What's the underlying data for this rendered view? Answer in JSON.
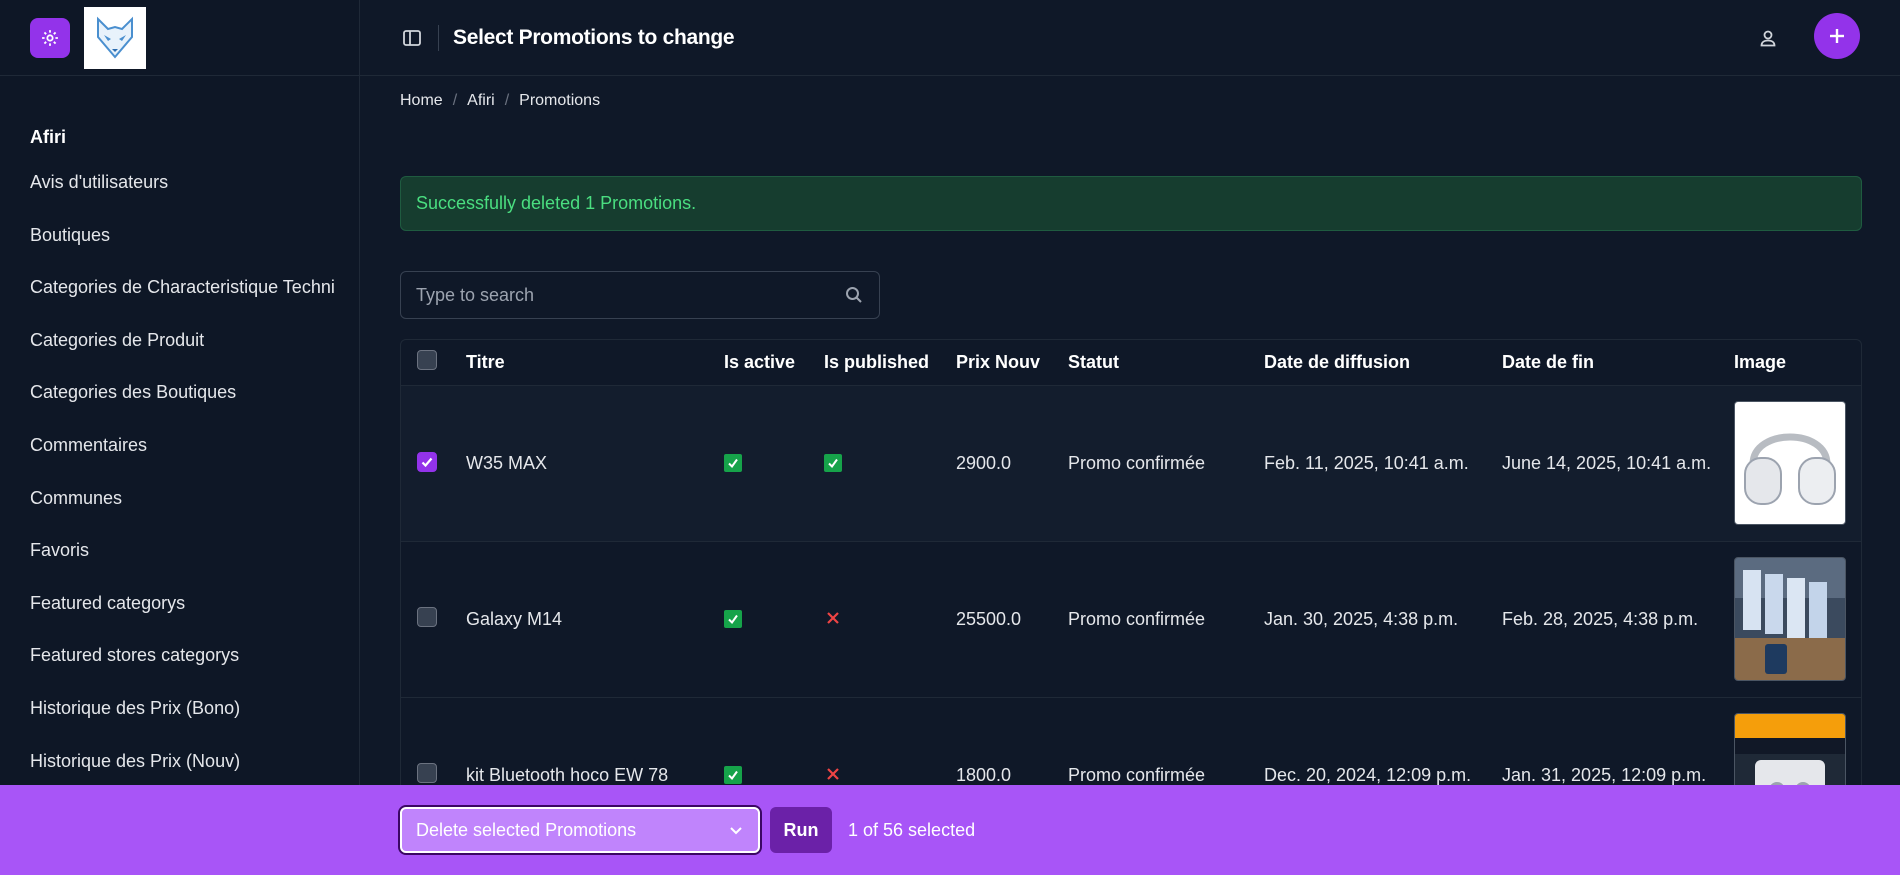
{
  "header": {
    "title": "Select Promotions to change"
  },
  "sidebar": {
    "section_title": "Afiri",
    "items": [
      {
        "label": "Avis d'utilisateurs"
      },
      {
        "label": "Boutiques"
      },
      {
        "label": "Categories de Characteristique Techni"
      },
      {
        "label": "Categories de Produit"
      },
      {
        "label": "Categories des Boutiques"
      },
      {
        "label": "Commentaires"
      },
      {
        "label": "Communes"
      },
      {
        "label": "Favoris"
      },
      {
        "label": "Featured categorys"
      },
      {
        "label": "Featured stores categorys"
      },
      {
        "label": "Historique des Prix (Bono)"
      },
      {
        "label": "Historique des Prix (Nouv)"
      }
    ]
  },
  "breadcrumb": {
    "home": "Home",
    "app": "Afiri",
    "current": "Promotions",
    "separator": "/"
  },
  "alert": {
    "message": "Successfully deleted 1 Promotions."
  },
  "search": {
    "placeholder": "Type to search"
  },
  "table": {
    "columns": {
      "titre": "Titre",
      "is_active": "Is active",
      "is_published": "Is published",
      "prix": "Prix Nouv",
      "statut": "Statut",
      "date_diffusion": "Date de diffusion",
      "date_fin": "Date de fin",
      "image": "Image"
    },
    "rows": [
      {
        "selected": true,
        "titre": "W35 MAX",
        "is_active": true,
        "is_published": true,
        "prix": "2900.0",
        "statut": "Promo confirmée",
        "date_diffusion": "Feb. 11, 2025, 10:41 a.m.",
        "date_fin": "June 14, 2025, 10:41 a.m."
      },
      {
        "selected": false,
        "titre": "Galaxy M14",
        "is_active": true,
        "is_published": false,
        "prix": "25500.0",
        "statut": "Promo confirmée",
        "date_diffusion": "Jan. 30, 2025, 4:38 p.m.",
        "date_fin": "Feb. 28, 2025, 4:38 p.m."
      },
      {
        "selected": false,
        "titre": "kit Bluetooth hoco EW 78",
        "is_active": true,
        "is_published": false,
        "prix": "1800.0",
        "statut": "Promo confirmée",
        "date_diffusion": "Dec. 20, 2024, 12:09 p.m.",
        "date_fin": "Jan. 31, 2025, 12:09 p.m."
      }
    ]
  },
  "actions": {
    "selected_action": "Delete selected Promotions",
    "run_label": "Run",
    "selection_count": "1 of 56 selected"
  },
  "colors": {
    "accent": "#9333ea",
    "action_bar": "#a855f7",
    "success_text": "#4ade80",
    "boolean_true": "#16a34a",
    "boolean_false": "#ef4444"
  }
}
